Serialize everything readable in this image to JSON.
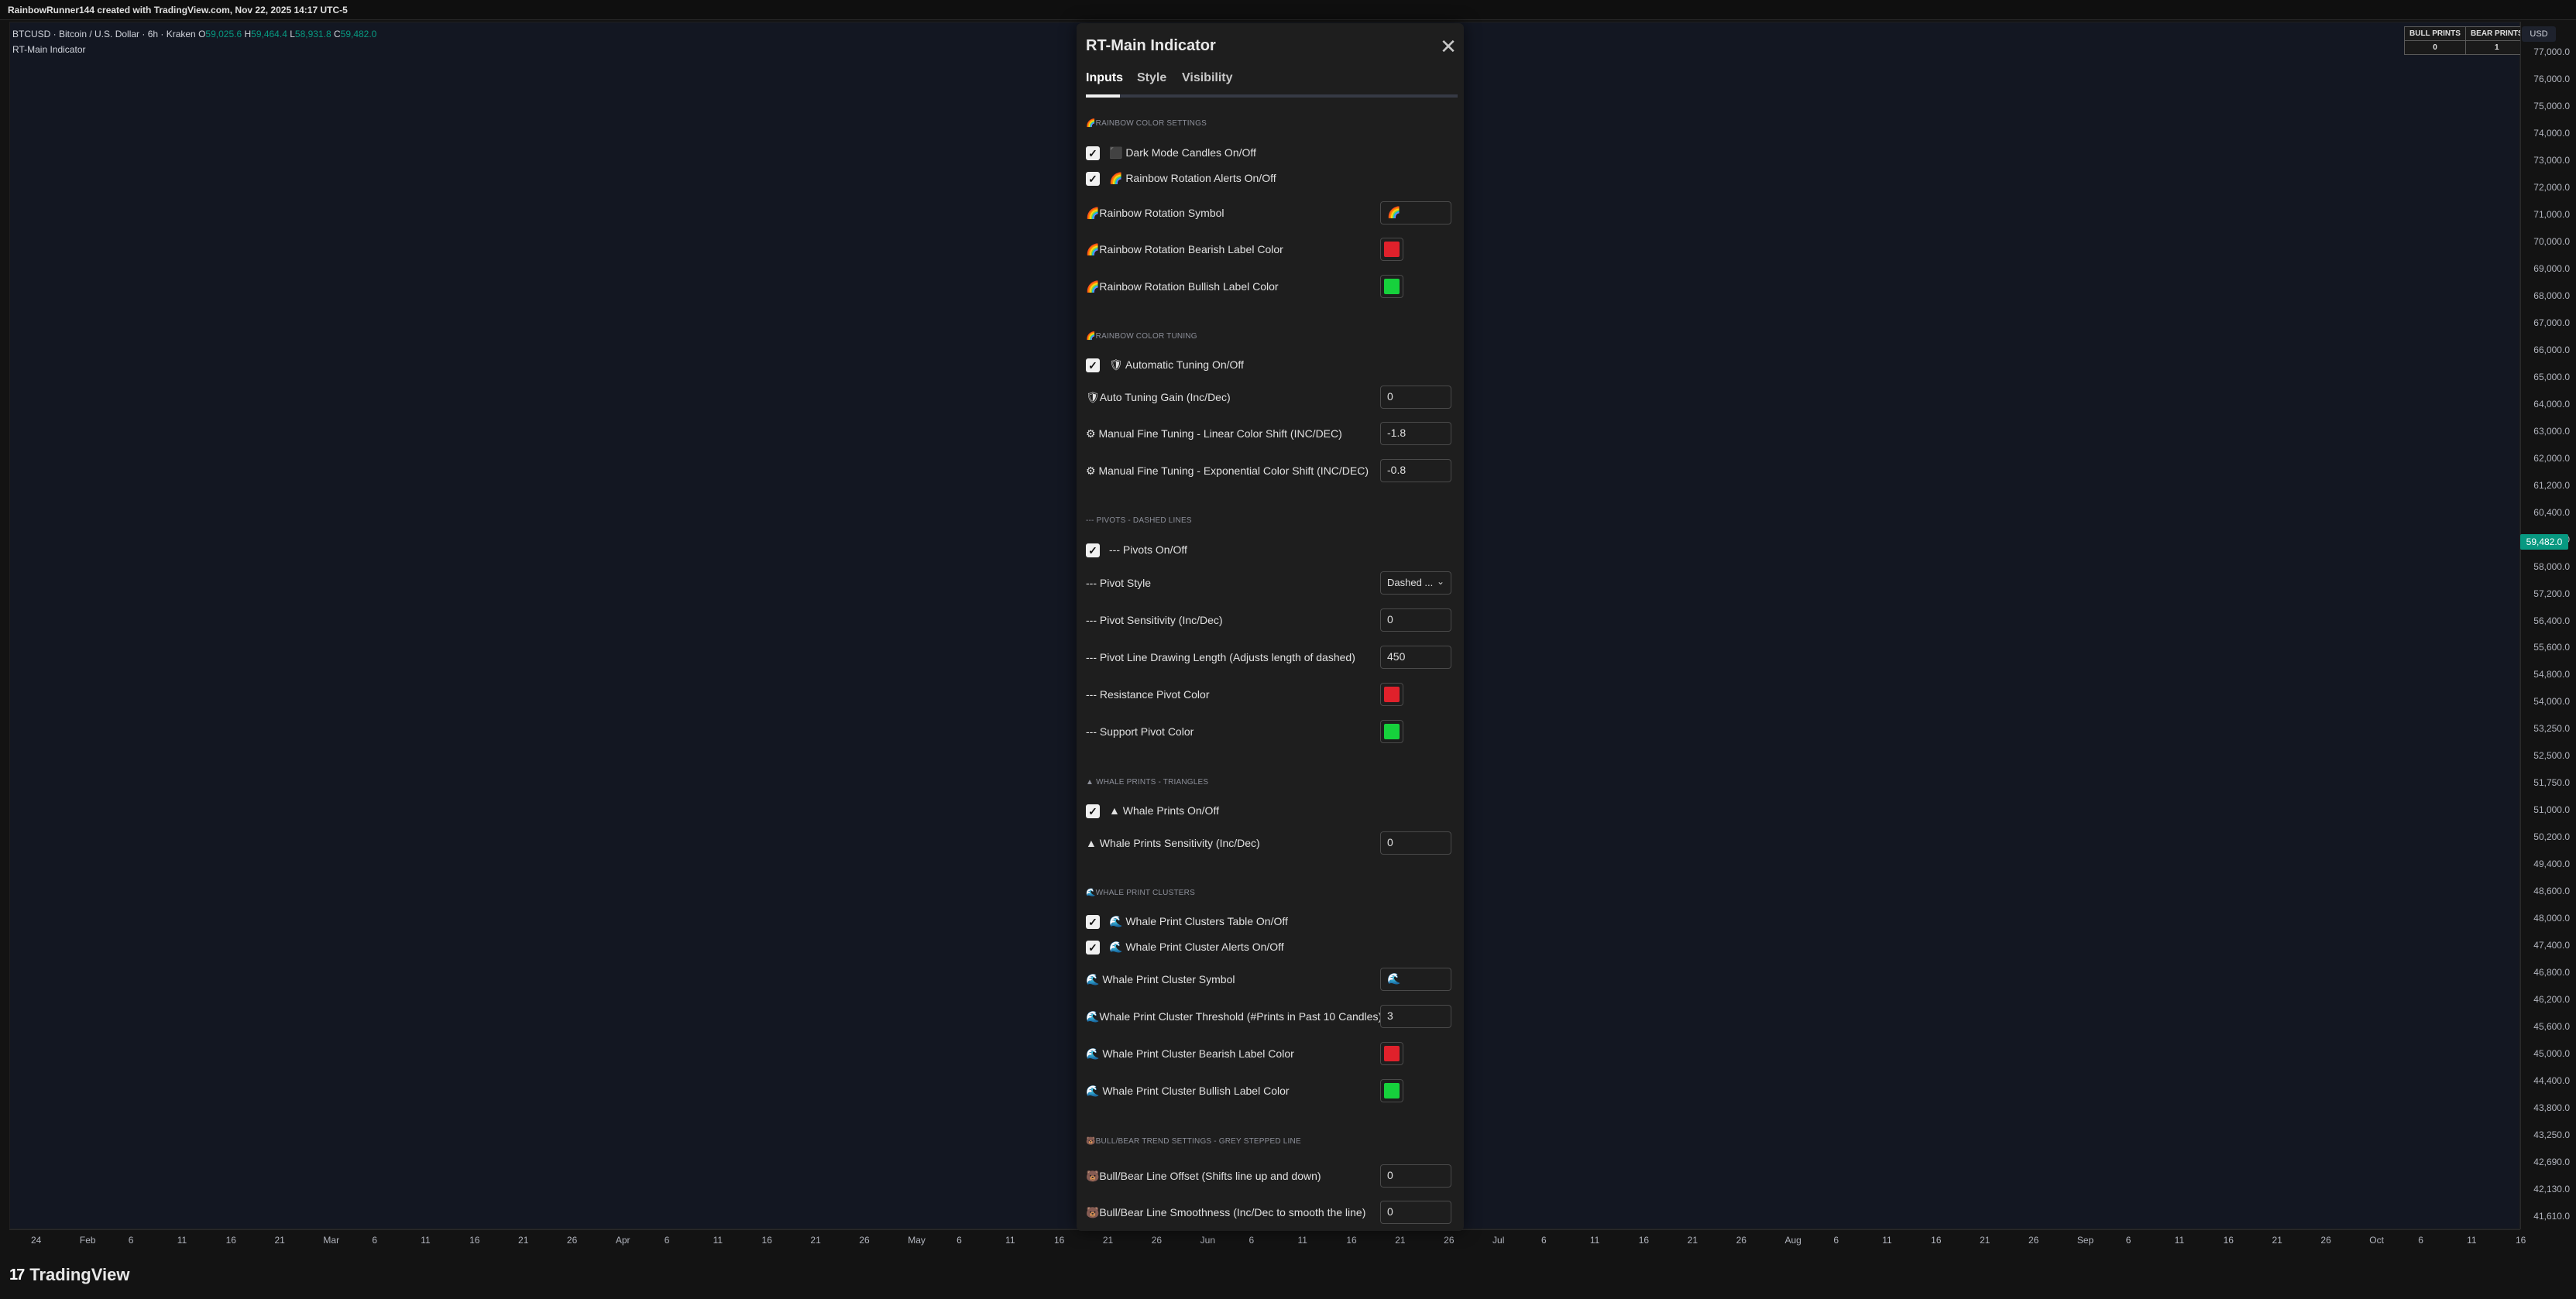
{
  "header": {
    "caption": "RainbowRunner144 created with TradingView.com, Nov 22, 2025 14:17 UTC-5"
  },
  "legend": {
    "symbol": "BTCUSD · Bitcoin / U.S. Dollar · 6h · Kraken",
    "o_label": "O",
    "o_value": "59,025.6",
    "h_label": "H",
    "h_value": "59,464.4",
    "l_label": "L",
    "l_value": "58,931.8",
    "c_label": "C",
    "c_value": "59,482.0",
    "indicator": "RT-Main Indicator"
  },
  "prints_table": {
    "headers": [
      "BULL PRINTS",
      "BEAR PRINTS"
    ],
    "values": [
      "0",
      "1"
    ]
  },
  "price_axis": {
    "currency": "USD",
    "current_price": "59,482.0",
    "ticks": [
      "77,000.0",
      "76,000.0",
      "75,000.0",
      "74,000.0",
      "73,000.0",
      "72,000.0",
      "71,000.0",
      "70,000.0",
      "69,000.0",
      "68,000.0",
      "67,000.0",
      "66,000.0",
      "65,000.0",
      "64,000.0",
      "63,000.0",
      "62,000.0",
      "61,200.0",
      "60,400.0",
      "58,800.0",
      "58,000.0",
      "57,200.0",
      "56,400.0",
      "55,600.0",
      "54,800.0",
      "54,000.0",
      "53,250.0",
      "52,500.0",
      "51,750.0",
      "51,000.0",
      "50,200.0",
      "49,400.0",
      "48,600.0",
      "48,000.0",
      "47,400.0",
      "46,800.0",
      "46,200.0",
      "45,600.0",
      "45,000.0",
      "44,400.0",
      "43,800.0",
      "43,250.0",
      "42,690.0",
      "42,130.0",
      "41,610.0"
    ]
  },
  "time_axis": {
    "labels": [
      "24",
      "Feb",
      "6",
      "11",
      "16",
      "21",
      "Mar",
      "6",
      "11",
      "16",
      "21",
      "26",
      "Apr",
      "6",
      "11",
      "16",
      "21",
      "26",
      "May",
      "6",
      "11",
      "16",
      "21",
      "26",
      "Jun",
      "6",
      "11",
      "16",
      "21",
      "26",
      "Jul",
      "6",
      "11",
      "16",
      "21",
      "26",
      "Aug",
      "6",
      "11",
      "16",
      "21",
      "26",
      "Sep",
      "6",
      "11",
      "16",
      "21",
      "26",
      "Oct",
      "6",
      "11",
      "16"
    ]
  },
  "footer": {
    "brand": "TradingView",
    "brand_mark": "17"
  },
  "dialog": {
    "title": "RT-Main Indicator",
    "close_glyph": "✕",
    "tabs": [
      "Inputs",
      "Style",
      "Visibility"
    ],
    "sections": {
      "rainbow_color_settings": "🌈RAINBOW COLOR SETTINGS",
      "rainbow_color_tuning": "🌈RAINBOW COLOR TUNING",
      "pivots": "--- PIVOTS - DASHED LINES",
      "whale_prints": "▲ WHALE PRINTS - TRIANGLES",
      "whale_clusters": "🌊WHALE PRINT CLUSTERS",
      "bull_bear": "🐻BULL/BEAR TREND SETTINGS - GREY STEPPED LINE"
    },
    "rows": {
      "dark_mode": "⬛ Dark Mode Candles On/Off",
      "rainbow_alerts": "🌈 Rainbow Rotation Alerts On/Off",
      "rainbow_symbol": "🌈Rainbow Rotation Symbol",
      "rainbow_symbol_value": "🌈",
      "rainbow_bearish": "🌈Rainbow Rotation Bearish Label Color",
      "rainbow_bullish": "🌈Rainbow Rotation Bullish Label Color",
      "auto_tuning": "🛡 Automatic Tuning On/Off",
      "auto_gain": "🛡Auto Tuning Gain (Inc/Dec)",
      "auto_gain_value": "0",
      "linear_shift": "⚙ Manual Fine Tuning - Linear Color Shift (INC/DEC)",
      "linear_shift_value": "-1.8",
      "exp_shift": "⚙ Manual Fine Tuning - Exponential Color Shift (INC/DEC)",
      "exp_shift_value": "-0.8",
      "pivots_onoff": "--- Pivots On/Off",
      "pivot_style": "--- Pivot Style",
      "pivot_style_value": "Dashed ...",
      "pivot_sens": "--- Pivot Sensitivity (Inc/Dec)",
      "pivot_sens_value": "0",
      "pivot_length": "--- Pivot Line Drawing Length (Adjusts length of dashed)",
      "pivot_length_value": "450",
      "resistance_color": "--- Resistance Pivot Color",
      "support_color": "--- Support Pivot Color",
      "whale_onoff": "▲ Whale Prints On/Off",
      "whale_sens": "▲ Whale Prints Sensitivity (Inc/Dec)",
      "whale_sens_value": "0",
      "cluster_table": "🌊 Whale Print Clusters Table On/Off",
      "cluster_alerts": "🌊 Whale Print Cluster Alerts On/Off",
      "cluster_symbol": "🌊 Whale Print Cluster Symbol",
      "cluster_symbol_value": "🌊",
      "cluster_threshold": "🌊Whale Print Cluster Threshold (#Prints in Past 10 Candles)",
      "cluster_threshold_value": "3",
      "cluster_bearish": "🌊 Whale Print Cluster Bearish Label Color",
      "cluster_bullish": "🌊 Whale Print Cluster Bullish Label Color",
      "bb_offset": "🐻Bull/Bear Line Offset (Shifts line up and down)",
      "bb_offset_value": "0",
      "bb_smooth": "🐻Bull/Bear Line Smoothness (Inc/Dec to smooth the line)",
      "bb_smooth_value": "0"
    },
    "colors": {
      "red": "#e0212b",
      "green": "#16d13c"
    }
  }
}
